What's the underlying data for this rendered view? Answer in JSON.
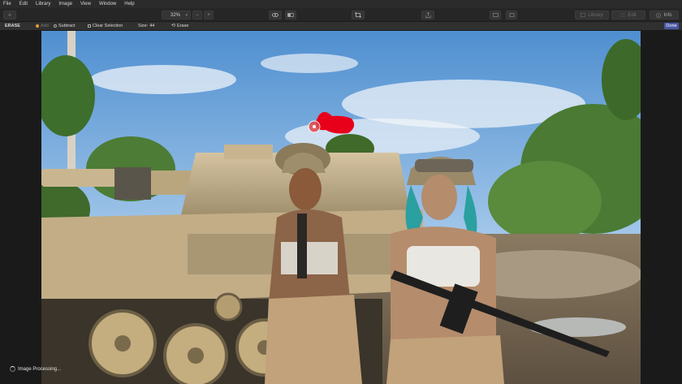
{
  "menu": [
    "File",
    "Edit",
    "Library",
    "Image",
    "View",
    "Window",
    "Help"
  ],
  "toolbar": {
    "zoom_value": "32%",
    "zoom_out": "−",
    "zoom_in": "+",
    "library_label": "Library",
    "edit_label": "Edit",
    "info_label": "Info"
  },
  "options": {
    "mode": "ERASE",
    "add": "Add",
    "subtract": "Subtract",
    "clear_selection": "Clear Selection",
    "size_label": "Size:",
    "size_value": "44",
    "erase": "Erase",
    "done": "Done"
  },
  "status": {
    "text": "Image Processing..."
  },
  "colors": {
    "accent": "#4a57a6",
    "brush": "#e8001a",
    "menubar": "#2b2b2b",
    "add_dot": "#e0a030"
  }
}
